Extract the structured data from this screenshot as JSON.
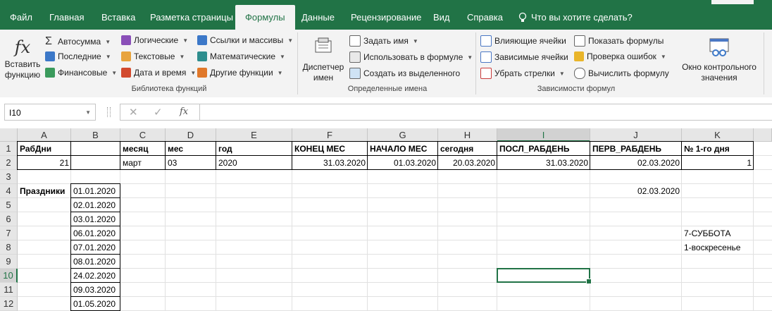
{
  "tabs": [
    {
      "label": "Файл",
      "active": false
    },
    {
      "label": "Главная",
      "active": false
    },
    {
      "label": "Вставка",
      "active": false
    },
    {
      "label": "Разметка страницы",
      "active": false
    },
    {
      "label": "Формулы",
      "active": true
    },
    {
      "label": "Данные",
      "active": false
    },
    {
      "label": "Рецензирование",
      "active": false
    },
    {
      "label": "Вид",
      "active": false
    },
    {
      "label": "Справка",
      "active": false
    }
  ],
  "tellme": "Что вы хотите сделать?",
  "ribbon": {
    "insert_function": {
      "line1": "Вставить",
      "line2": "функцию"
    },
    "lib": {
      "autosum": "Автосумма",
      "recent": "Последние",
      "financial": "Финансовые",
      "logical": "Логические",
      "text": "Текстовые",
      "datetime": "Дата и время",
      "lookup": "Ссылки и массивы",
      "math": "Математические",
      "more": "Другие функции",
      "group": "Библиотека функций"
    },
    "names": {
      "manager_line1": "Диспетчер",
      "manager_line2": "имен",
      "define": "Задать имя",
      "use": "Использовать в формуле",
      "create": "Создать из выделенного",
      "group": "Определенные имена"
    },
    "audit": {
      "precedents": "Влияющие ячейки",
      "dependents": "Зависимые ячейки",
      "remove": "Убрать стрелки",
      "show": "Показать формулы",
      "check": "Проверка ошибок",
      "evaluate": "Вычислить формулу",
      "group": "Зависимости формул"
    },
    "watch": {
      "line1": "Окно контрольного",
      "line2": "значения"
    }
  },
  "formula_bar": {
    "name_box": "I10",
    "fx": "fx",
    "content": ""
  },
  "colors": {
    "accent": "#217346"
  },
  "columns": [
    "A",
    "B",
    "C",
    "D",
    "E",
    "F",
    "G",
    "H",
    "I",
    "J",
    "K"
  ],
  "rows": [
    "1",
    "2",
    "3",
    "4",
    "5",
    "6",
    "7",
    "8",
    "9",
    "10",
    "11",
    "12"
  ],
  "selected_cell": "I10",
  "cells": {
    "A1": "РабДни",
    "C1": "месяц",
    "D1": "мес",
    "E1": "год",
    "F1": "КОНЕЦ МЕС",
    "G1": "НАЧАЛО МЕС",
    "H1": "сегодня",
    "I1": "ПОСЛ_РАБДЕНЬ",
    "J1": "ПЕРВ_РАБДЕНЬ",
    "K1": "№ 1-го дня",
    "A2": "21",
    "C2": "март",
    "D2": "03",
    "E2": "2020",
    "F2": "31.03.2020",
    "G2": "01.03.2020",
    "H2": "20.03.2020",
    "I2": "31.03.2020",
    "J2": "02.03.2020",
    "K2": "1",
    "A4": "Праздники",
    "B4": "01.01.2020",
    "J4": "02.03.2020",
    "B5": "02.01.2020",
    "B6": "03.01.2020",
    "B7": "06.01.2020",
    "K7": "7-СУББОТА",
    "B8": "07.01.2020",
    "K8": "1-воскресенье",
    "B9": "08.01.2020",
    "B10": "24.02.2020",
    "B11": "09.03.2020",
    "B12": "01.05.2020"
  }
}
